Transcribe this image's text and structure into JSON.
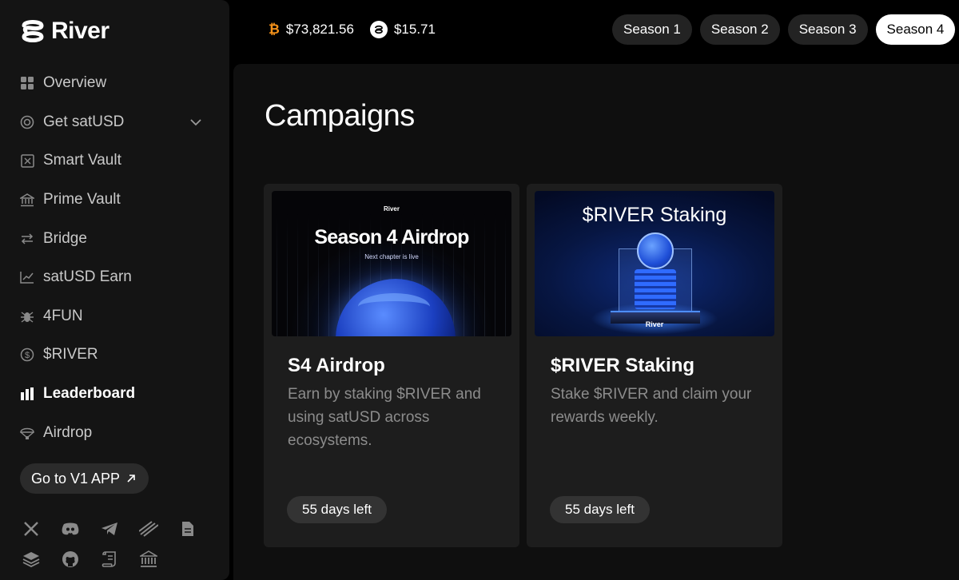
{
  "brand": {
    "name": "River"
  },
  "sidebar": {
    "items": [
      {
        "label": "Overview",
        "icon": "grid-icon"
      },
      {
        "label": "Get satUSD",
        "icon": "target-icon"
      },
      {
        "label": "Smart Vault",
        "icon": "vault-icon"
      },
      {
        "label": "Prime Vault",
        "icon": "bank-icon"
      },
      {
        "label": "Bridge",
        "icon": "arrows-swap-icon"
      },
      {
        "label": "satUSD Earn",
        "icon": "trend-chart-icon"
      },
      {
        "label": "4FUN",
        "icon": "bug-icon"
      },
      {
        "label": "$RIVER",
        "icon": "dollar-coin-icon"
      },
      {
        "label": "Leaderboard",
        "icon": "bars-icon",
        "active": true
      },
      {
        "label": "Airdrop",
        "icon": "parachute-icon"
      }
    ],
    "v1_button": "Go to V1 APP",
    "social_icons": [
      "x-icon",
      "discord-icon",
      "telegram-icon",
      "mirror-icon",
      "docs-icon",
      "layers-icon",
      "github-icon",
      "scroll-icon",
      "bank-icon"
    ]
  },
  "prices": {
    "btc": "$73,821.56",
    "river": "$15.71"
  },
  "seasons": [
    "Season 1",
    "Season 2",
    "Season 3",
    "Season 4"
  ],
  "active_season": "Season 4",
  "main": {
    "title": "Campaigns",
    "cards": [
      {
        "title": "S4 Airdrop",
        "description": "Earn by staking $RIVER and using satUSD across ecosystems.",
        "badge": "55 days left",
        "banner": {
          "brand": "River",
          "headline": "Season 4 Airdrop",
          "subtitle": "Next chapter is live"
        }
      },
      {
        "title": "$RIVER Staking",
        "description": "Stake $RIVER and claim your rewards weekly.",
        "badge": "55 days left",
        "banner": {
          "brand": "River",
          "headline": "$RIVER Staking"
        }
      }
    ]
  },
  "colors": {
    "btc": "#f7931a",
    "accent_blue": "#2f6bff",
    "card_bg": "#1d1d1d",
    "page_bg": "#000000"
  }
}
